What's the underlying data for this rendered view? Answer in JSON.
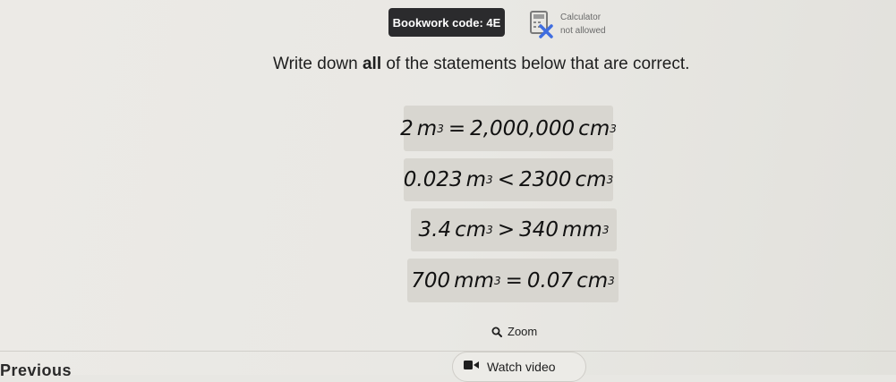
{
  "header": {
    "bookwork_label": "Bookwork code: 4E",
    "calculator_line1": "Calculator",
    "calculator_line2": "not allowed"
  },
  "question": {
    "instruction_prefix": "Write down ",
    "instruction_bold": "all",
    "instruction_suffix": " of the statements below that are correct."
  },
  "statements": [
    {
      "left_value": "2",
      "left_unit": "m",
      "relation": "=",
      "right_value": "2,000,000",
      "right_unit": "cm",
      "power": "3"
    },
    {
      "left_value": "0.023",
      "left_unit": "m",
      "relation": "<",
      "right_value": "2300",
      "right_unit": "cm",
      "power": "3"
    },
    {
      "left_value": "3.4",
      "left_unit": "cm",
      "relation": ">",
      "right_value": "340",
      "right_unit": "mm",
      "power": "3"
    },
    {
      "left_value": "700",
      "left_unit": "mm",
      "relation": "=",
      "right_value": "0.07",
      "right_unit": "cm",
      "power": "3"
    }
  ],
  "controls": {
    "zoom_label": "Zoom",
    "previous_label": "Previous",
    "watch_video_label": "Watch video"
  },
  "colors": {
    "badge_bg": "#2b2b2d",
    "card_bg": "#d8d6d0",
    "calculator_cross": "#3f6de0"
  }
}
